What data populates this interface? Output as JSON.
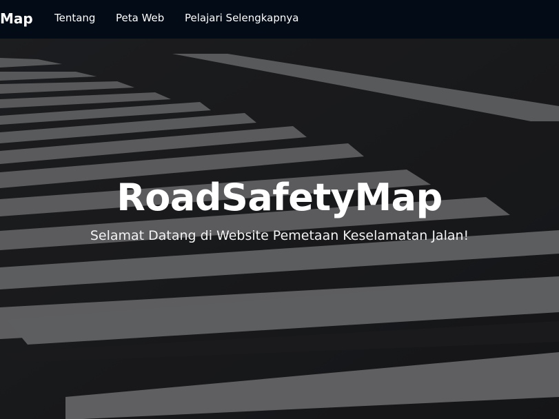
{
  "navbar": {
    "brand": "Map",
    "links": [
      "Tentang",
      "Peta Web",
      "Pelajari Selengkapnya"
    ]
  },
  "hero": {
    "title": "RoadSafetyMap",
    "subtitle": "Selamat Datang di Website Pemetaan Keselamatan Jalan!"
  },
  "colors": {
    "navbar_bg": "#020b16",
    "text": "#ffffff"
  }
}
